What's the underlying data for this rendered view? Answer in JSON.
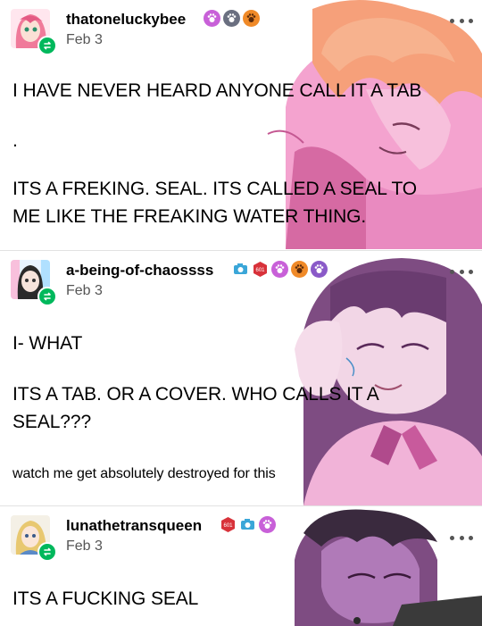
{
  "posts": [
    {
      "username": "thatoneluckybee",
      "date": "Feb 3",
      "badges": [
        "paw-badge-pink",
        "paw-badge-gray",
        "paw-badge-orange"
      ],
      "lines": [
        "I HAVE NEVER HEARD ANYONE CALL IT A TAB",
        ".",
        "ITS A FREKING. SEAL. ITS CALLED A SEAL TO",
        "ME LIKE THE FREAKING WATER THING."
      ]
    },
    {
      "username": "a-being-of-chaossss",
      "date": "Feb 3",
      "badges": [
        "camera-badge-blue",
        "hex-badge-red",
        "paw-badge-pink",
        "paw-badge-orange",
        "paw-badge-purple"
      ],
      "lines": [
        "I- WHAT",
        "ITS A TAB. OR A COVER. WHO CALLS IT A",
        "SEAL???"
      ],
      "small_text": "watch me get absolutely destroyed for this"
    },
    {
      "username": "lunathetransqueen",
      "date": "Feb 3",
      "badges": [
        "hex-badge-red",
        "camera-badge-blue",
        "paw-badge-pink"
      ],
      "lines": [
        "ITS A FUCKING SEAL"
      ]
    }
  ],
  "colors": {
    "reblog_green": "#00b85c",
    "text": "#000000",
    "date_gray": "#555555",
    "art_pink": "#e98ac0",
    "art_purple": "#9a6a9e"
  }
}
